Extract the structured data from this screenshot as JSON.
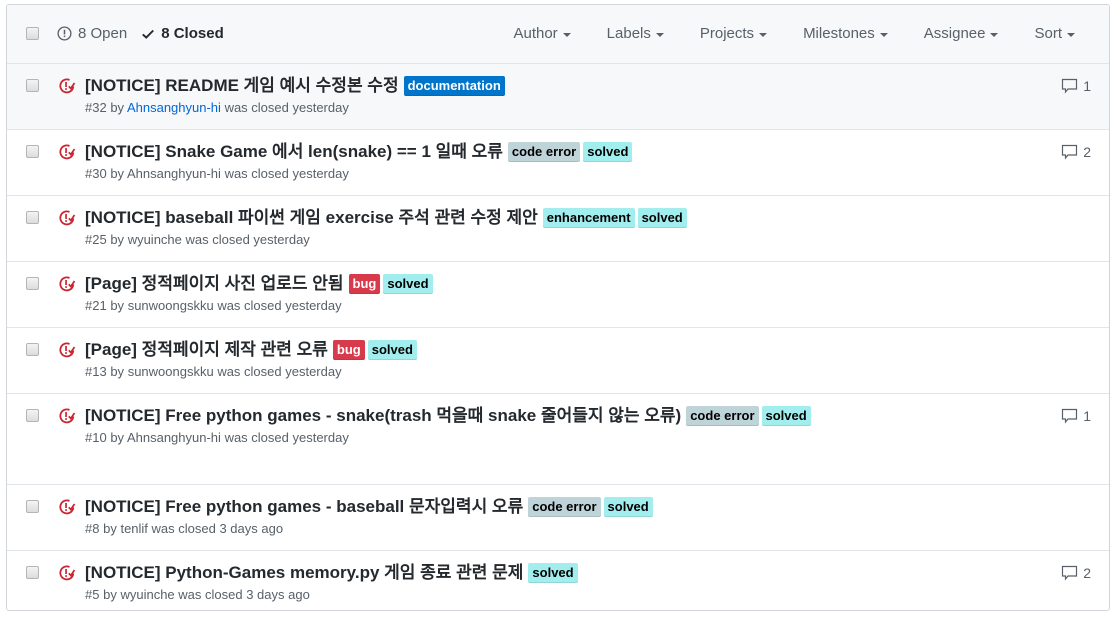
{
  "header": {
    "open_count_label": "8 Open",
    "closed_count_label": "8 Closed",
    "filters": [
      "Author",
      "Labels",
      "Projects",
      "Milestones",
      "Assignee",
      "Sort"
    ]
  },
  "label_colors": {
    "documentation": {
      "bg": "#0075ca",
      "fg": "#ffffff"
    },
    "code error": {
      "bg": "#bfd4d9",
      "fg": "#000000"
    },
    "solved": {
      "bg": "#a2eeef",
      "fg": "#000000"
    },
    "enhancement": {
      "bg": "#a2eeef",
      "fg": "#000000"
    },
    "bug": {
      "bg": "#d73a4a",
      "fg": "#ffffff"
    }
  },
  "issues": [
    {
      "title": "[NOTICE] README 게임 예시 수정본 수정",
      "labels": [
        "documentation"
      ],
      "number": "#32",
      "by": "by",
      "author": "Ahnsanghyun-hi",
      "author_link": true,
      "closed": "was closed yesterday",
      "comments": "1"
    },
    {
      "title": "[NOTICE] Snake Game 에서 len(snake) == 1 일때 오류",
      "labels": [
        "code error",
        "solved"
      ],
      "number": "#30",
      "by": "by",
      "author": "Ahnsanghyun-hi",
      "closed": "was closed yesterday",
      "comments": "2"
    },
    {
      "title": "[NOTICE] baseball 파이썬 게임 exercise 주석 관련 수정 제안",
      "labels": [
        "enhancement",
        "solved"
      ],
      "number": "#25",
      "by": "by",
      "author": "wyuinche",
      "closed": "was closed yesterday",
      "comments": null
    },
    {
      "title": "[Page] 정적페이지 사진 업로드 안됨",
      "labels": [
        "bug",
        "solved"
      ],
      "number": "#21",
      "by": "by",
      "author": "sunwoongskku",
      "closed": "was closed yesterday",
      "comments": null
    },
    {
      "title": "[Page] 정적페이지 제작 관련 오류",
      "labels": [
        "bug",
        "solved"
      ],
      "number": "#13",
      "by": "by",
      "author": "sunwoongskku",
      "closed": "was closed yesterday",
      "comments": null
    },
    {
      "title": "[NOTICE] Free python games - snake(trash 먹을때 snake 줄어들지 않는 오류)",
      "labels": [
        "code error",
        "solved"
      ],
      "number": "#10",
      "by": "by",
      "author": "Ahnsanghyun-hi",
      "closed": "was closed yesterday",
      "comments": "1"
    },
    {
      "title": "[NOTICE] Free python games - baseball 문자입력시 오류",
      "labels": [
        "code error",
        "solved"
      ],
      "number": "#8",
      "by": "by",
      "author": "tenlif",
      "closed": "was closed 3 days ago",
      "comments": null
    },
    {
      "title": "[NOTICE] Python-Games memory.py 게임 종료 관련 문제",
      "labels": [
        "solved"
      ],
      "number": "#5",
      "by": "by",
      "author": "wyuinche",
      "closed": "was closed 3 days ago",
      "comments": "2"
    }
  ]
}
